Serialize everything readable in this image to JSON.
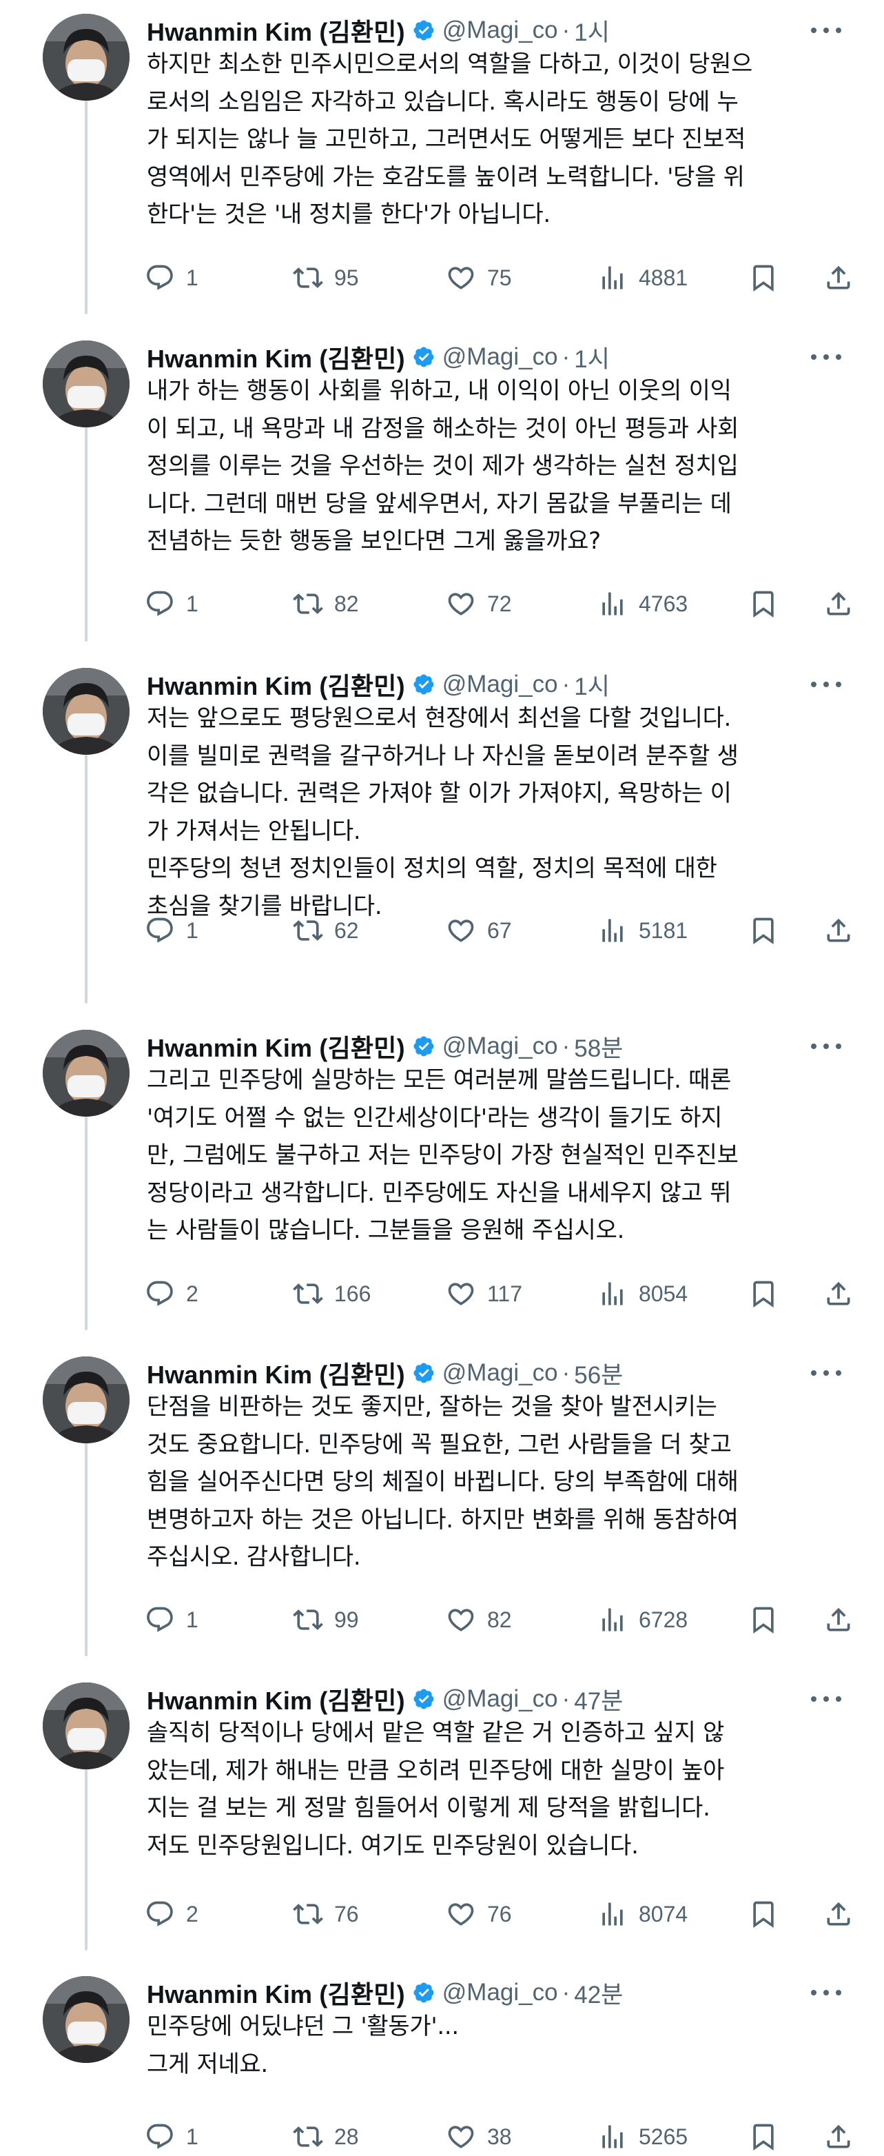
{
  "author": {
    "display_name": "Hwanmin Kim (김환민)",
    "handle": "@Magi_co",
    "verified_icon": "verified-badge-icon",
    "verified_color": "#1d9bf0"
  },
  "colors": {
    "text": "#0f1419",
    "secondary": "#536471",
    "thread_line": "#cfd9de"
  },
  "icons": {
    "reply": "reply-icon",
    "retweet": "retweet-icon",
    "like": "like-icon",
    "views": "views-icon",
    "bookmark": "bookmark-icon",
    "share": "share-icon",
    "more": "more-icon"
  },
  "tweets": [
    {
      "time": "1시",
      "text": "하지만 최소한 민주시민으로서의 역할을 다하고, 이것이 당원으\n로서의 소임임은 자각하고 있습니다. 혹시라도 행동이 당에 누\n가 되지는 않나 늘 고민하고, 그러면서도 어떻게든 보다 진보적\n영역에서 민주당에 가는 호감도를 높이려 노력합니다. '당을 위\n한다'는 것은 '내 정치를 한다'가 아닙니다.",
      "replies": "1",
      "retweets": "95",
      "likes": "75",
      "views": "4881"
    },
    {
      "time": "1시",
      "text": "내가 하는 행동이 사회를 위하고, 내 이익이 아닌 이웃의 이익\n이 되고, 내 욕망과 내 감정을 해소하는 것이 아닌 평등과 사회\n정의를 이루는 것을 우선하는 것이 제가 생각하는 실천 정치입\n니다. 그런데 매번 당을 앞세우면서, 자기 몸값을 부풀리는 데\n전념하는 듯한 행동을 보인다면 그게 옳을까요?",
      "replies": "1",
      "retweets": "82",
      "likes": "72",
      "views": "4763"
    },
    {
      "time": "1시",
      "text": "저는 앞으로도 평당원으로서 현장에서 최선을 다할 것입니다.\n이를 빌미로 권력을 갈구하거나 나 자신을 돋보이려 분주할 생\n각은 없습니다. 권력은 가져야 할 이가 가져야지, 욕망하는 이\n가 가져서는 안됩니다.\n민주당의 청년 정치인들이 정치의 역할, 정치의 목적에 대한\n초심을 찾기를 바랍니다.",
      "replies": "1",
      "retweets": "62",
      "likes": "67",
      "views": "5181"
    },
    {
      "time": "58분",
      "text": "그리고 민주당에 실망하는 모든 여러분께 말씀드립니다. 때론\n'여기도 어쩔 수 없는 인간세상이다'라는 생각이 들기도 하지\n만, 그럼에도 불구하고 저는 민주당이 가장 현실적인 민주진보\n정당이라고 생각합니다. 민주당에도 자신을 내세우지 않고 뛰\n는 사람들이 많습니다. 그분들을 응원해 주십시오.",
      "replies": "2",
      "retweets": "166",
      "likes": "117",
      "views": "8054"
    },
    {
      "time": "56분",
      "text": "단점을 비판하는 것도 좋지만, 잘하는 것을 찾아 발전시키는\n것도 중요합니다. 민주당에 꼭 필요한, 그런 사람들을 더 찾고\n힘을 실어주신다면 당의 체질이 바뀝니다. 당의 부족함에 대해\n변명하고자 하는 것은 아닙니다. 하지만 변화를 위해 동참하여\n주십시오. 감사합니다.",
      "replies": "1",
      "retweets": "99",
      "likes": "82",
      "views": "6728"
    },
    {
      "time": "47분",
      "text": "솔직히 당적이나 당에서 맡은 역할 같은 거 인증하고 싶지 않\n았는데, 제가 해내는 만큼 오히려 민주당에 대한 실망이 높아\n지는 걸 보는 게 정말 힘들어서 이렇게 제 당적을 밝힙니다.\n저도 민주당원입니다. 여기도 민주당원이 있습니다.",
      "replies": "2",
      "retweets": "76",
      "likes": "76",
      "views": "8074"
    },
    {
      "time": "42분",
      "text": "민주당에 어딨냐던 그 '활동가'...\n그게 저네요.",
      "replies": "1",
      "retweets": "28",
      "likes": "38",
      "views": "5265"
    }
  ]
}
